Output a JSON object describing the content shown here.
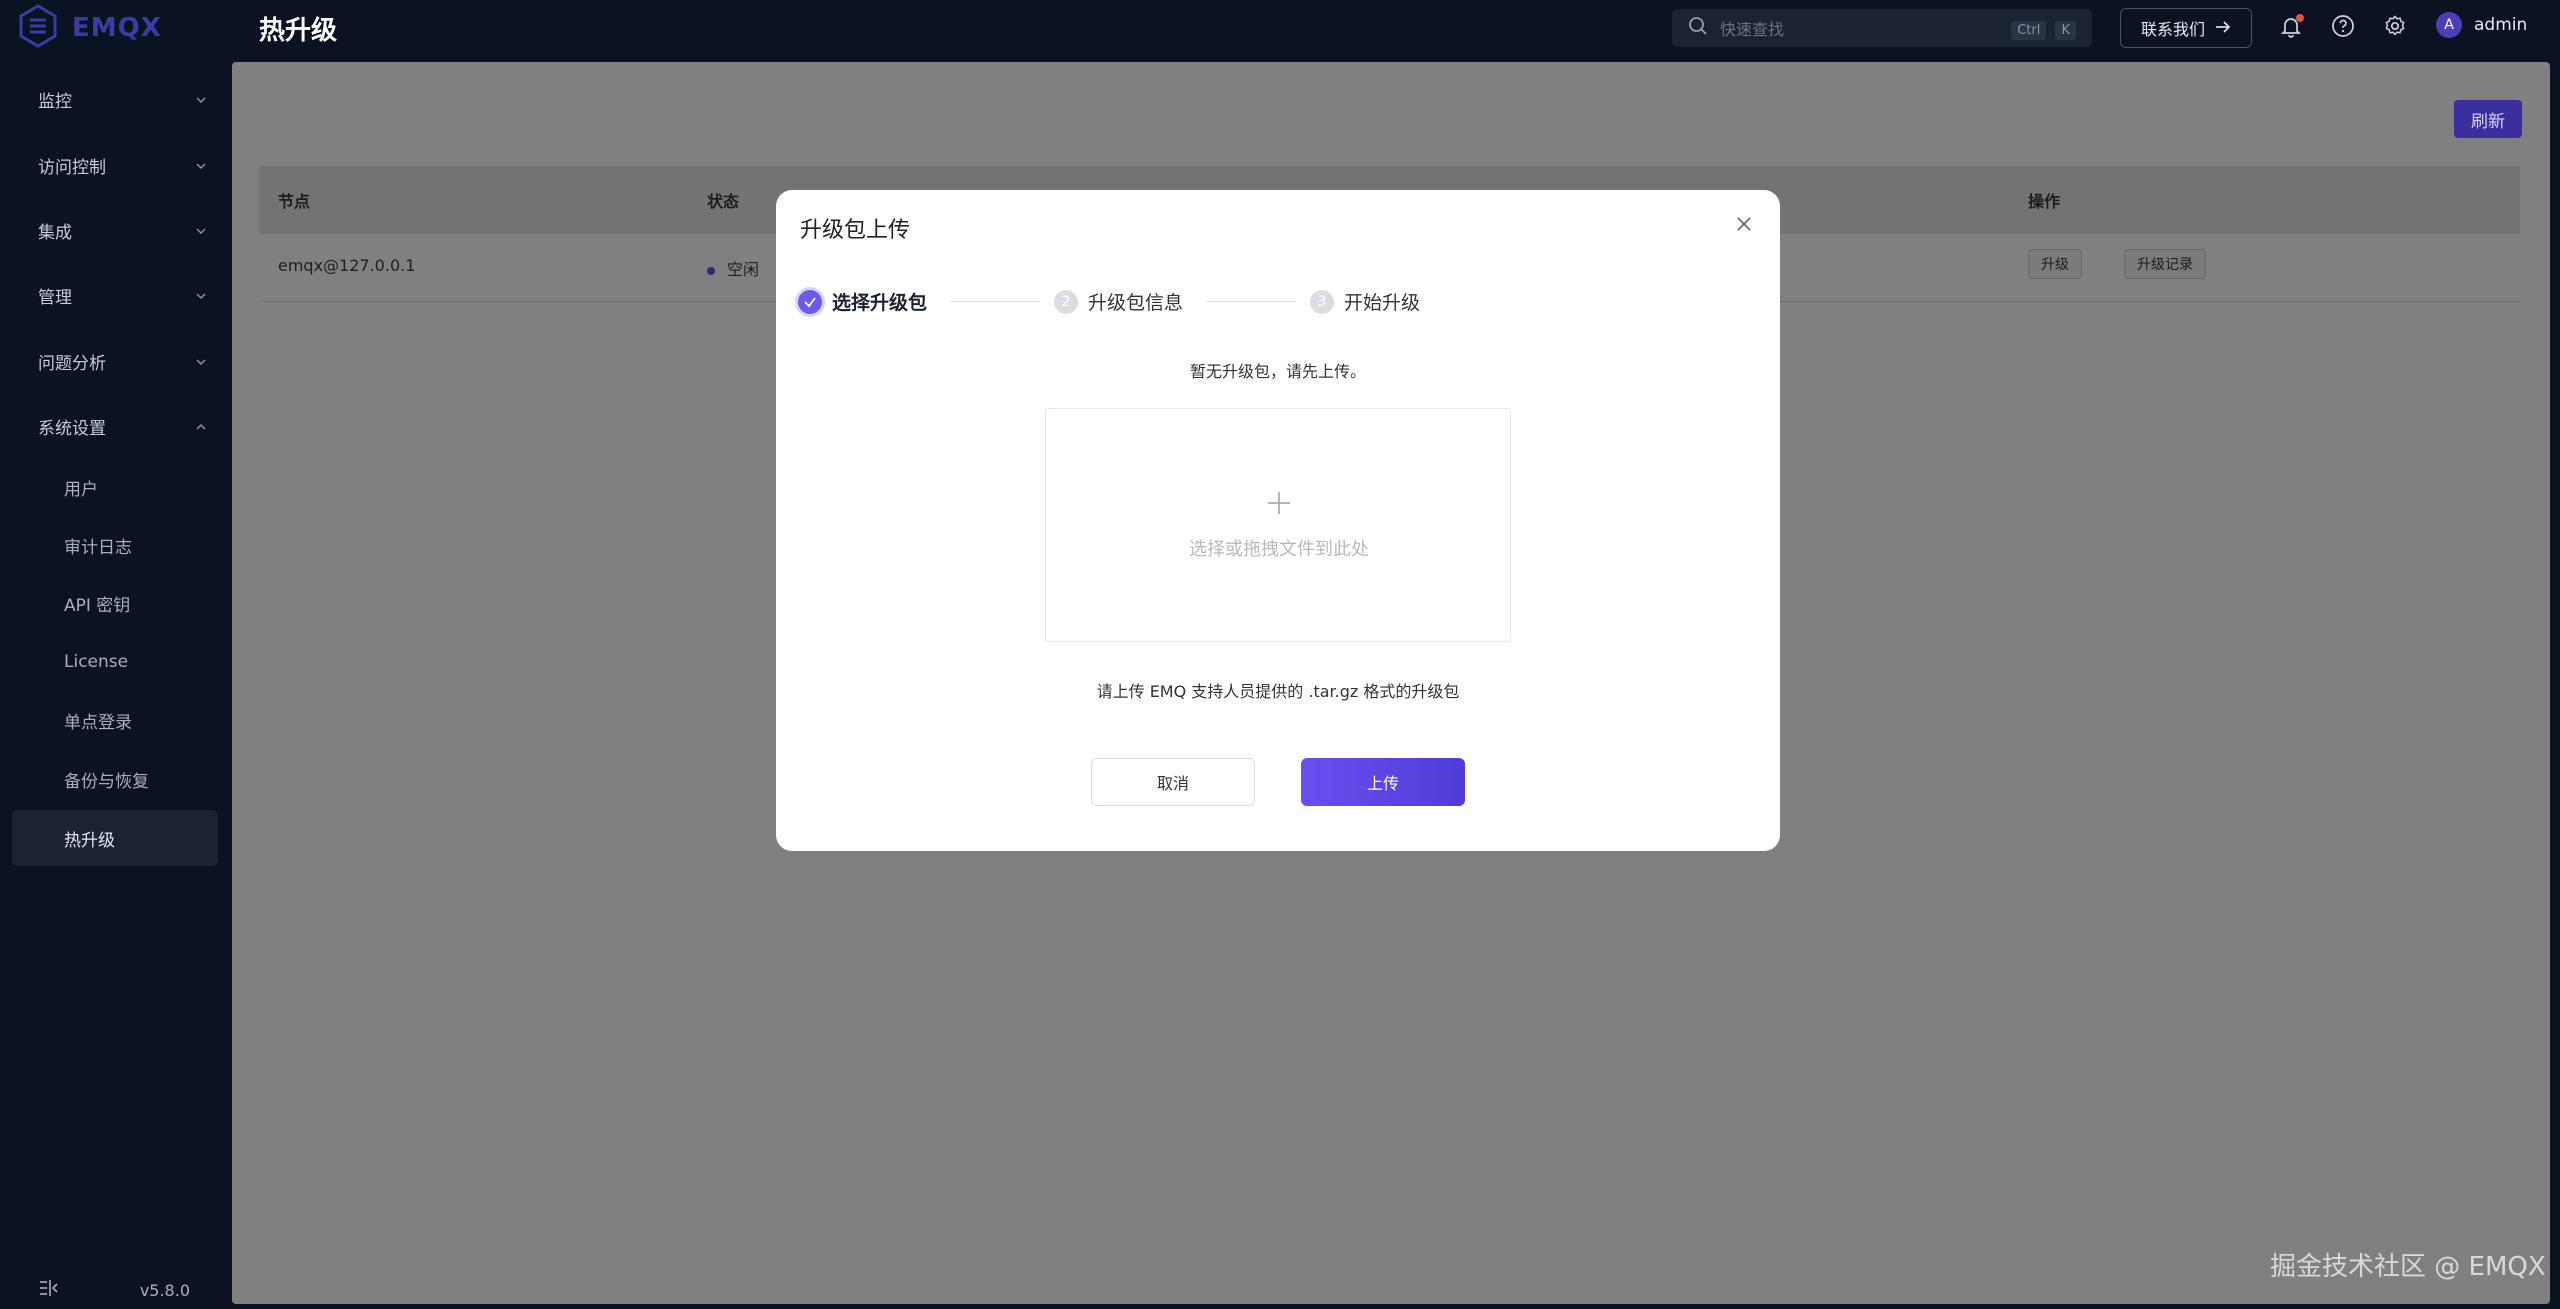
{
  "brand": {
    "name": "EMQX"
  },
  "header": {
    "title": "热升级",
    "search_placeholder": "快速查找",
    "shortcut_keys": [
      "Ctrl",
      "K"
    ],
    "contact_label": "联系我们",
    "username": "admin",
    "avatar_letter": "A"
  },
  "sidebar": {
    "groups": [
      {
        "label": "监控"
      },
      {
        "label": "访问控制"
      },
      {
        "label": "集成"
      },
      {
        "label": "管理"
      },
      {
        "label": "问题分析"
      },
      {
        "label": "系统设置"
      }
    ],
    "system_items": [
      {
        "label": "用户"
      },
      {
        "label": "审计日志"
      },
      {
        "label": "API 密钥"
      },
      {
        "label": "License"
      },
      {
        "label": "单点登录"
      },
      {
        "label": "备份与恢复"
      },
      {
        "label": "热升级",
        "active": true
      }
    ],
    "version": "v5.8.0"
  },
  "main": {
    "refresh_label": "刷新",
    "table": {
      "columns": [
        "节点",
        "状态",
        "操作"
      ],
      "rows": [
        {
          "node": "emqx@127.0.0.1",
          "status": "空闲",
          "actions": [
            "升级",
            "升级记录"
          ]
        }
      ]
    }
  },
  "modal": {
    "title": "升级包上传",
    "steps": [
      {
        "number": "1",
        "label": "选择升级包",
        "state": "current"
      },
      {
        "number": "2",
        "label": "升级包信息",
        "state": "todo"
      },
      {
        "number": "3",
        "label": "开始升级",
        "state": "todo"
      }
    ],
    "empty_hint": "暂无升级包，请先上传。",
    "dropzone_text": "选择或拖拽文件到此处",
    "format_hint": "请上传 EMQ 支持人员提供的 .tar.gz 格式的升级包",
    "cancel_label": "取消",
    "upload_label": "上传"
  },
  "watermark": "掘金技术社区 @ EMQX",
  "colors": {
    "accent": "#6b5ce7",
    "brand": "#3d3aa6",
    "background": "#0b1222"
  }
}
